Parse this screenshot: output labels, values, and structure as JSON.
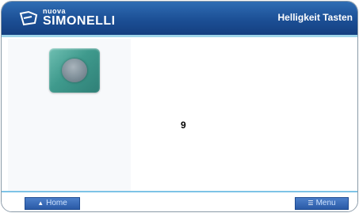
{
  "header": {
    "logo_small": "nuova",
    "logo_big": "SIMONELLI",
    "title": "Helligkeit Tasten"
  },
  "main": {
    "value": "9",
    "button_icon": "brightness-disc-icon"
  },
  "footer": {
    "home_label": "Home",
    "home_icon": "home-icon",
    "menu_label": "Menu",
    "menu_icon": "menu-icon"
  },
  "colors": {
    "header_blue": "#1c4f95",
    "accent_cyan": "#7dc3e6",
    "button_teal": "#3f9a8d"
  }
}
